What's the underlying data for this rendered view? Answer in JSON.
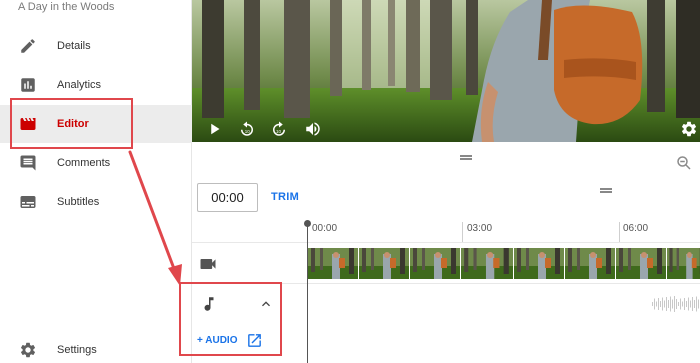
{
  "sidebar": {
    "video_title": "A Day in the Woods",
    "items": [
      {
        "label": "Details",
        "icon": "pencil-icon"
      },
      {
        "label": "Analytics",
        "icon": "analytics-icon"
      },
      {
        "label": "Editor",
        "icon": "clapperboard-icon",
        "active": true
      },
      {
        "label": "Comments",
        "icon": "comment-icon"
      },
      {
        "label": "Subtitles",
        "icon": "subtitles-icon"
      }
    ],
    "settings_label": "Settings"
  },
  "player": {
    "controls": [
      "play-icon",
      "rewind-10-icon",
      "forward-10-icon",
      "volume-icon",
      "settings-gear-icon"
    ]
  },
  "editor": {
    "current_time": "00:00",
    "trim_label": "TRIM",
    "add_audio_label": "+ AUDIO",
    "ruler": [
      "00:00",
      "03:00",
      "06:00"
    ],
    "tracks": [
      "video-track",
      "audio-track"
    ]
  },
  "colors": {
    "accent_blue": "#1a73e8",
    "active_red": "#cc0000",
    "annotation_red": "#e0474c"
  }
}
